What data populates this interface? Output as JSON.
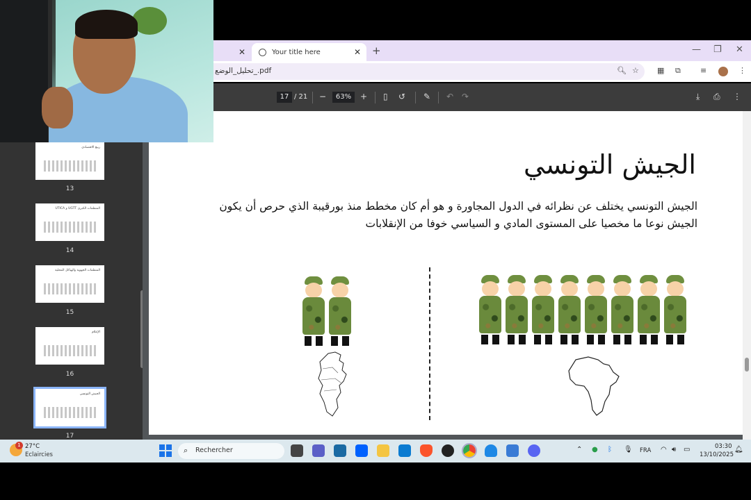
{
  "browser": {
    "tab_title": "Your title here",
    "url": "تحليل_الوضع_.pdf"
  },
  "pdf_toolbar": {
    "current_page": "17",
    "page_total": "/ 21",
    "zoom": "63%"
  },
  "sidebar": {
    "thumbnails": [
      {
        "page": "13",
        "title": "ربيع الاقتصادي"
      },
      {
        "page": "14",
        "title": "UTICA و UGTT المنظمات الكبرى"
      },
      {
        "page": "15",
        "title": "المنظمات الجهوية والهياكل المحلية"
      },
      {
        "page": "16",
        "title": "الإعلام"
      },
      {
        "page": "17",
        "title": "الجيش التونسي"
      }
    ]
  },
  "slide": {
    "title": "الجيش التونسي",
    "body": "الجيش التونسي يختلف عن نظرائه في الدول المجاورة و هو أم كان مخطط منذ بورقيبة الذي حرص أن يكون الجيش نوعا ما مخصيا على المستوى المادي و السياسي خوفا من الإنقلابات",
    "left_soldier_count": 2,
    "right_soldier_count": 8
  },
  "taskbar": {
    "weather_temp": "27°C",
    "weather_desc": "Eclaircies",
    "weather_badge": "1",
    "search_placeholder": "Rechercher",
    "language": "FRA",
    "time": "03:30",
    "date": "13/10/2025"
  },
  "colors": {
    "tab_strip": "#e8def7",
    "pdf_toolbar": "#3c3c3c",
    "sidebar": "#333333",
    "taskbar": "#dce8ee",
    "accent": "#1a73e8"
  }
}
